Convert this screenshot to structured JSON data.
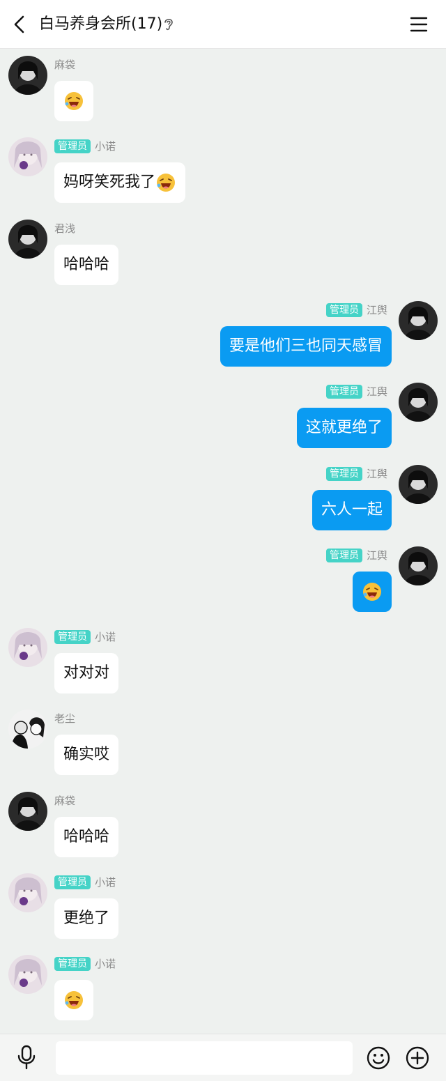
{
  "header": {
    "title": "白马养身会所(17)"
  },
  "messages": [
    {
      "side": "left",
      "sender": "麻袋",
      "badge": "",
      "text": "",
      "emoji": true,
      "avatar": "dark"
    },
    {
      "side": "left",
      "sender": "小诺",
      "badge": "管理员",
      "text": "妈呀笑死我了",
      "emoji": true,
      "avatar": "pink"
    },
    {
      "side": "left",
      "sender": "君浅",
      "badge": "",
      "text": "哈哈哈",
      "emoji": false,
      "avatar": "dark"
    },
    {
      "side": "right",
      "sender": "江舆",
      "badge": "管理员",
      "text": "要是他们三也同天感冒",
      "emoji": false,
      "avatar": "dark"
    },
    {
      "side": "right",
      "sender": "江舆",
      "badge": "管理员",
      "text": "这就更绝了",
      "emoji": false,
      "avatar": "dark"
    },
    {
      "side": "right",
      "sender": "江舆",
      "badge": "管理员",
      "text": "六人一起",
      "emoji": false,
      "avatar": "dark"
    },
    {
      "side": "right",
      "sender": "江舆",
      "badge": "管理员",
      "text": "",
      "emoji": true,
      "avatar": "dark"
    },
    {
      "side": "left",
      "sender": "小诺",
      "badge": "管理员",
      "text": "对对对",
      "emoji": false,
      "avatar": "pink"
    },
    {
      "side": "left",
      "sender": "老尘",
      "badge": "",
      "text": "确实哎",
      "emoji": false,
      "avatar": "bw"
    },
    {
      "side": "left",
      "sender": "麻袋",
      "badge": "",
      "text": "哈哈哈",
      "emoji": false,
      "avatar": "dark"
    },
    {
      "side": "left",
      "sender": "小诺",
      "badge": "管理员",
      "text": "更绝了",
      "emoji": false,
      "avatar": "pink"
    },
    {
      "side": "left",
      "sender": "小诺",
      "badge": "管理员",
      "text": "",
      "emoji": true,
      "avatar": "pink"
    }
  ],
  "input": {
    "placeholder": ""
  },
  "icons": {
    "back": "back-arrow-icon",
    "ear": "ear-icon",
    "menu": "menu-icon",
    "mic": "microphone-icon",
    "emoji": "smiley-icon",
    "plus": "plus-icon"
  },
  "colors": {
    "accent": "#0a9bf2",
    "badge": "#45d3c7",
    "background": "#eef1ef"
  }
}
